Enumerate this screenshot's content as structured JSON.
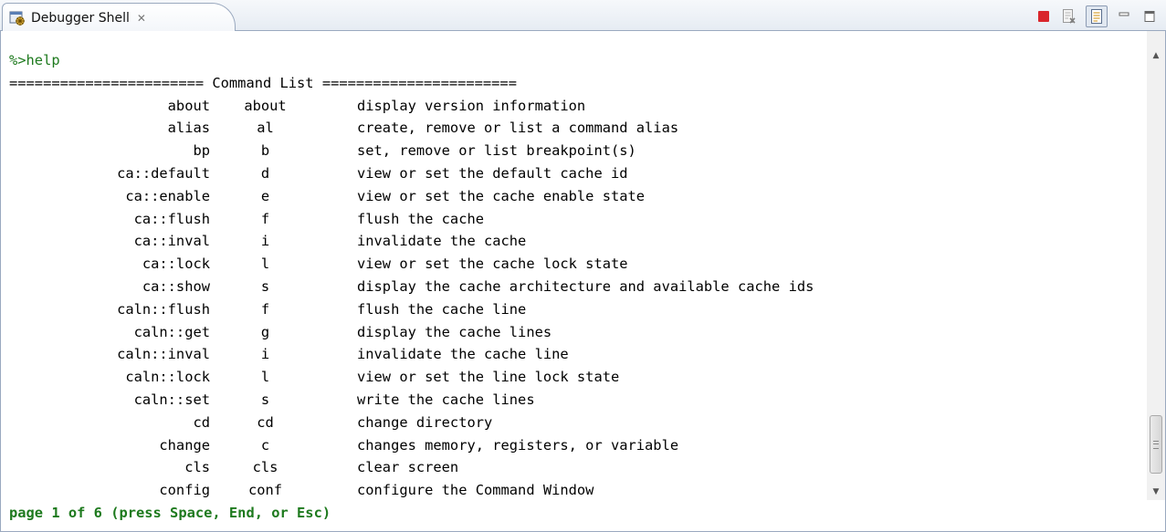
{
  "tab": {
    "title": "Debugger Shell",
    "close_glyph": "✕",
    "icon": "debugger-shell-icon"
  },
  "toolbar": {
    "icons": [
      "stop-icon",
      "clear-console-icon",
      "scroll-lock-icon",
      "minimize-icon",
      "maximize-icon"
    ],
    "stop_color": "#d9262c"
  },
  "console": {
    "prompt_line": "%>help",
    "header_line": "======================= Command List =======================",
    "commands": [
      {
        "name": "about",
        "alias": "about",
        "desc": "display version information"
      },
      {
        "name": "alias",
        "alias": "al",
        "desc": "create, remove or list a command alias"
      },
      {
        "name": "bp",
        "alias": "b",
        "desc": "set, remove or list breakpoint(s)"
      },
      {
        "name": "ca::default",
        "alias": "d",
        "desc": "view or set the default cache id"
      },
      {
        "name": "ca::enable",
        "alias": "e",
        "desc": "view or set the cache enable state"
      },
      {
        "name": "ca::flush",
        "alias": "f",
        "desc": "flush the cache"
      },
      {
        "name": "ca::inval",
        "alias": "i",
        "desc": "invalidate the cache"
      },
      {
        "name": "ca::lock",
        "alias": "l",
        "desc": "view or set the cache lock state"
      },
      {
        "name": "ca::show",
        "alias": "s",
        "desc": "display the cache architecture and available cache ids"
      },
      {
        "name": "caln::flush",
        "alias": "f",
        "desc": "flush the cache line"
      },
      {
        "name": "caln::get",
        "alias": "g",
        "desc": "display the cache lines"
      },
      {
        "name": "caln::inval",
        "alias": "i",
        "desc": "invalidate the cache line"
      },
      {
        "name": "caln::lock",
        "alias": "l",
        "desc": "view or set the line lock state"
      },
      {
        "name": "caln::set",
        "alias": "s",
        "desc": "write the cache lines"
      },
      {
        "name": "cd",
        "alias": "cd",
        "desc": "change directory"
      },
      {
        "name": "change",
        "alias": "c",
        "desc": "changes memory, registers, or variable"
      },
      {
        "name": "cls",
        "alias": "cls",
        "desc": "clear screen"
      },
      {
        "name": "config",
        "alias": "conf",
        "desc": "configure the Command Window"
      }
    ],
    "status_line": "page 1 of 6 (press Space, End, or Esc)",
    "prompt_color": "#1e7a1e"
  },
  "scrollbar": {
    "up_glyph": "▲",
    "down_glyph": "▼"
  }
}
